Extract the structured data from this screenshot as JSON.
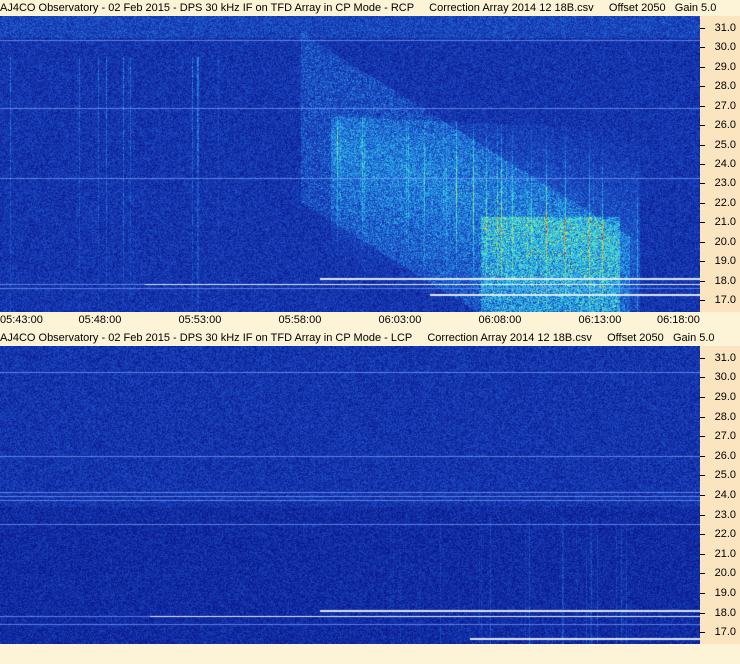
{
  "chart_data": [
    {
      "type": "heatmap",
      "title": "AJ4CO Observatory - 02 Feb 2015 - DPS 30 kHz IF on TFD Array in CP Mode - RCP",
      "correction": "Correction Array 2014 12 18B.csv",
      "offset": "Offset 2050",
      "gain": "Gain 5.0",
      "x_ticks": [
        "05:43:00",
        "05:48:00",
        "05:53:00",
        "05:58:00",
        "06:03:00",
        "06:08:00",
        "06:13:00",
        "06:18:00"
      ],
      "y_ticks": [
        "31.0",
        "30.0",
        "29.0",
        "28.0",
        "27.0",
        "26.0",
        "25.0",
        "24.0",
        "23.0",
        "22.0",
        "21.0",
        "20.0",
        "19.0",
        "18.0",
        "17.0"
      ],
      "ylim": [
        16.4,
        31.6
      ],
      "xlim": [
        "05:43:00",
        "06:18:00"
      ]
    },
    {
      "type": "heatmap",
      "title": "AJ4CO Observatory - 02 Feb 2015 - DPS 30 kHz IF on TFD Array in CP Mode - LCP",
      "correction": "Correction Array 2014 12 18B.csv",
      "offset": "Offset 2050",
      "gain": "Gain 5.0",
      "y_ticks": [
        "31.0",
        "30.0",
        "29.0",
        "28.0",
        "27.0",
        "26.0",
        "25.0",
        "24.0",
        "23.0",
        "22.0",
        "21.0",
        "20.0",
        "19.0",
        "18.0",
        "17.0"
      ],
      "ylim": [
        16.4,
        31.6
      ]
    }
  ]
}
